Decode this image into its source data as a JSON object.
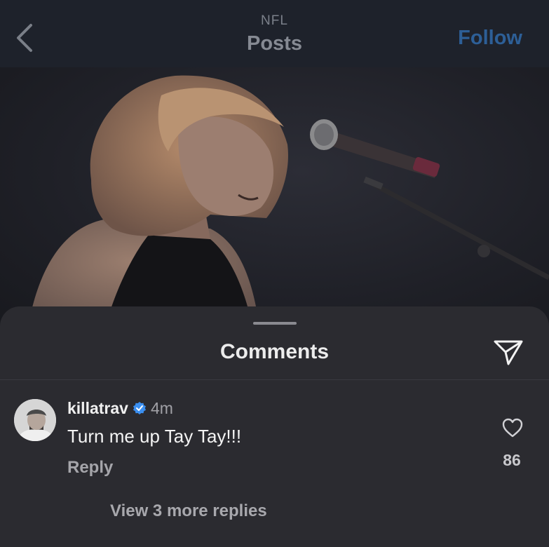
{
  "header": {
    "account": "NFL",
    "title": "Posts",
    "follow_label": "Follow",
    "back_icon": "chevron-left-icon"
  },
  "photo": {
    "description_icon": "photo"
  },
  "comments_sheet": {
    "title": "Comments",
    "share_icon": "send-icon"
  },
  "comment": {
    "username": "killatrav",
    "verified": true,
    "time": "4m",
    "text": "Turn me up Tay Tay!!!",
    "reply_label": "Reply",
    "likes": "86",
    "view_replies": "View 3 more replies"
  },
  "colors": {
    "header_bg": "#1e222b",
    "sheet_bg": "#2b2b30",
    "follow": "#2d5f97",
    "verified": "#3b8ff0"
  }
}
